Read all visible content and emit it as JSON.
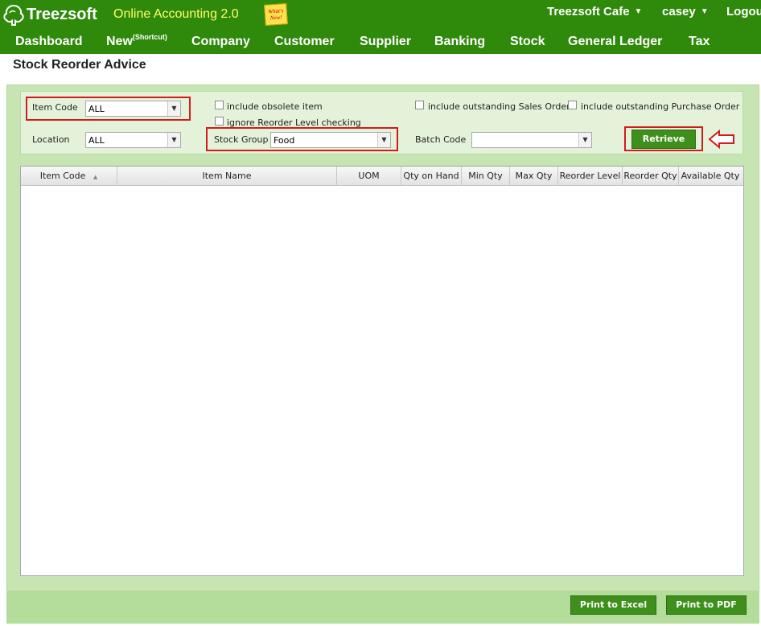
{
  "header": {
    "logo_text": "Treezsoft",
    "app_name": "Online Accounting 2.0",
    "whats_new": "What's New!",
    "company": "Treezsoft Cafe",
    "user": "casey",
    "logout": "Logout"
  },
  "nav": {
    "items": [
      "Dashboard",
      "New",
      "Company",
      "Customer",
      "Supplier",
      "Banking",
      "Stock",
      "General Ledger",
      "Tax"
    ],
    "new_sup": "(Shortcut)"
  },
  "page": {
    "title": "Stock Reorder Advice"
  },
  "filters": {
    "item_code_label": "Item Code",
    "item_code_value": "ALL",
    "location_label": "Location",
    "location_value": "ALL",
    "include_obsolete": "include obsolete item",
    "ignore_reorder": "ignore Reorder Level checking",
    "stock_group_label": "Stock Group",
    "stock_group_value": "Food",
    "include_sales_order": "include outstanding Sales Order",
    "include_purchase_order": "include outstanding Purchase Order",
    "batch_code_label": "Batch Code",
    "batch_code_value": "",
    "retrieve": "Retrieve"
  },
  "grid": {
    "columns": [
      "Item Code",
      "Item Name",
      "UOM",
      "Qty on Hand",
      "Min Qty",
      "Max Qty",
      "Reorder Level",
      "Reorder Qty",
      "Available Qty"
    ],
    "sort_indicator": "▲"
  },
  "footer": {
    "print_excel": "Print to Excel",
    "print_pdf": "Print to PDF"
  },
  "colors": {
    "brand_green": "#2f8a0b",
    "button_green": "#3f8f1c",
    "highlight_red": "#d01c1c",
    "app_name_yellow": "#ffff66"
  }
}
